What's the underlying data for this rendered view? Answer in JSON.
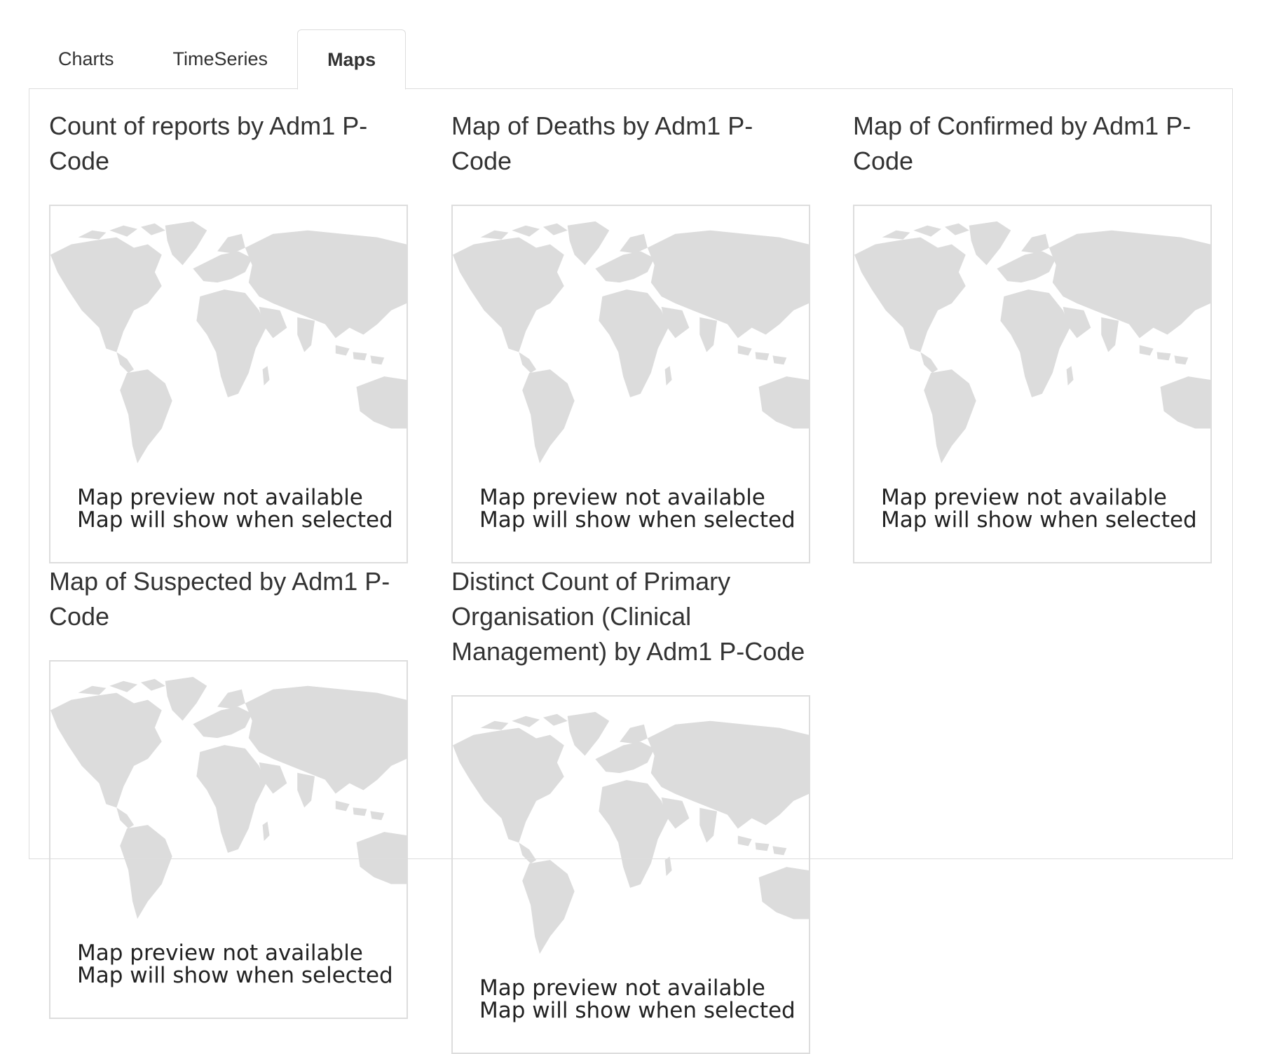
{
  "tabs": [
    {
      "label": "Charts",
      "active": false
    },
    {
      "label": "TimeSeries",
      "active": false
    },
    {
      "label": "Maps",
      "active": true
    }
  ],
  "maps": [
    {
      "title": "Count of reports by Adm1 P-Code"
    },
    {
      "title": "Map of Deaths by Adm1 P-Code"
    },
    {
      "title": "Map of Confirmed by Adm1 P-Code"
    },
    {
      "title": "Map of Suspected by Adm1 P-Code"
    },
    {
      "title": "Distinct Count of Primary Organisation (Clinical Management) by Adm1 P-Code"
    }
  ],
  "preview": {
    "line1": "Map preview not available",
    "line2": "Map will show when selected"
  },
  "colors": {
    "land": "#dcdcdc",
    "border": "#dddddd",
    "text": "#333333"
  }
}
